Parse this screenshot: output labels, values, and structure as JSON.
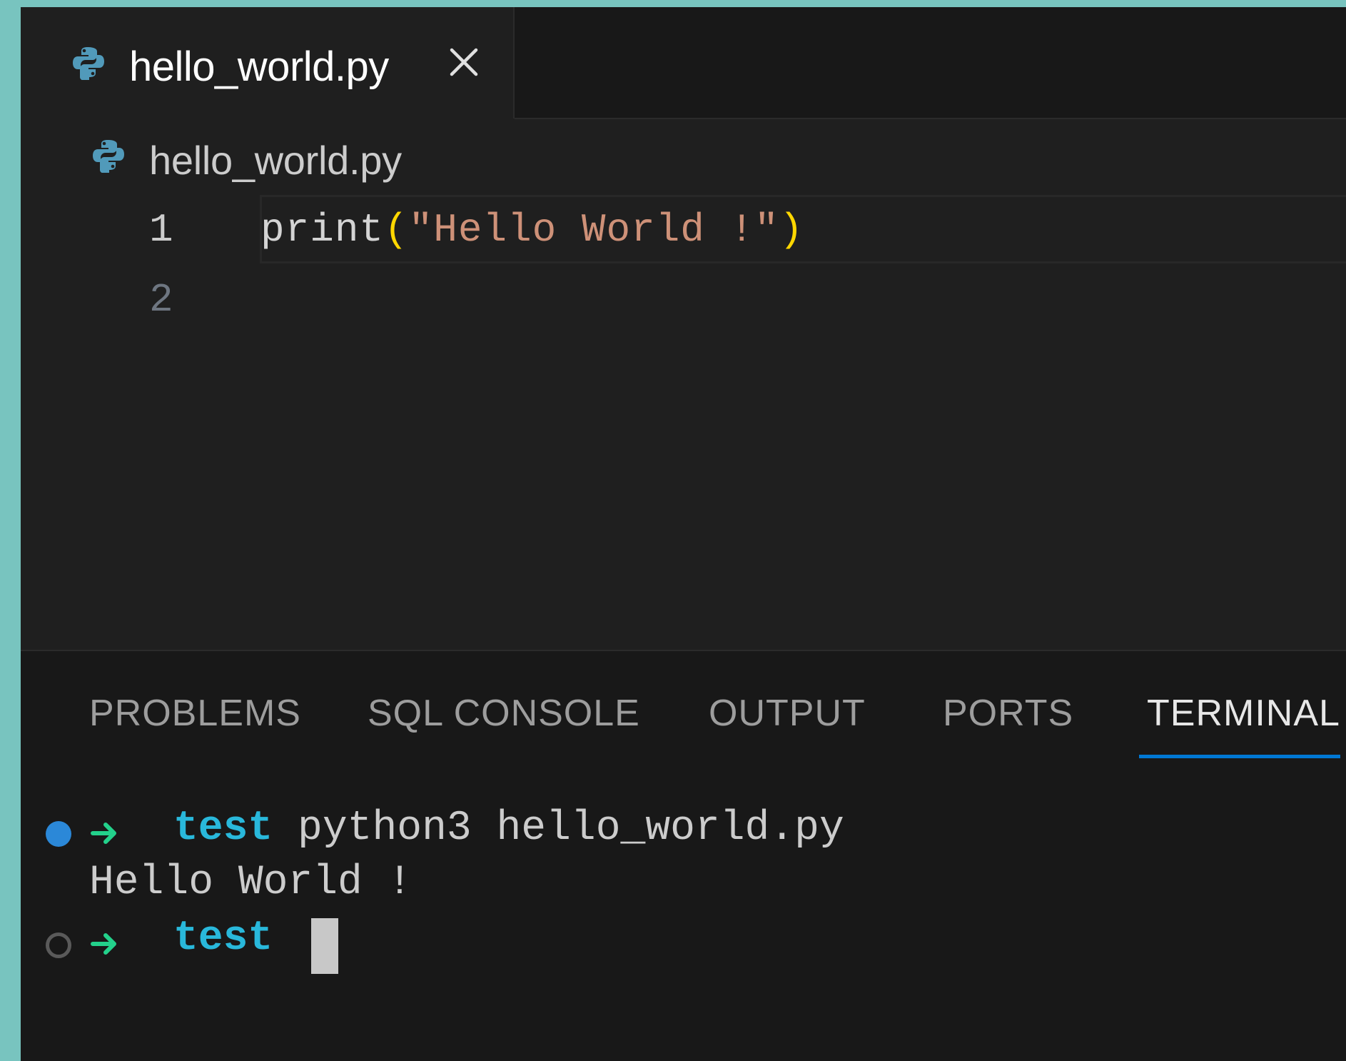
{
  "editor_tab": {
    "label": "hello_world.py",
    "icon": "python-icon",
    "close_icon": "close-icon"
  },
  "breadcrumb": {
    "label": "hello_world.py",
    "icon": "python-icon"
  },
  "editor": {
    "line_numbers": [
      "1",
      "2"
    ],
    "code": {
      "fn": "print",
      "open_paren": "(",
      "string": "\"Hello World !\"",
      "close_paren": ")"
    }
  },
  "panel": {
    "tabs": {
      "problems": "PROBLEMS",
      "sql_console": "SQL CONSOLE",
      "output": "OUTPUT",
      "ports": "PORTS",
      "terminal": "TERMINAL"
    },
    "active_tab": "TERMINAL"
  },
  "terminal": {
    "cwd": "test",
    "command": "python3 hello_world.py",
    "output": "Hello World !",
    "prompt_cwd": "test"
  },
  "colors": {
    "accent": "#0078d4",
    "cwd": "#29b8db",
    "arrow": "#23d18b",
    "string": "#ce9178",
    "paren": "#ffd700",
    "python_icon": "#519aba"
  }
}
